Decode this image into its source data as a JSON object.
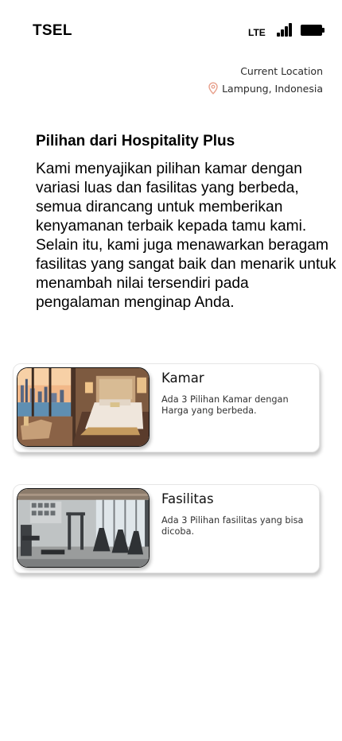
{
  "status_bar": {
    "carrier": "TSEL",
    "network": "LTE",
    "icons": [
      "signal-bars-icon",
      "battery-icon"
    ]
  },
  "location": {
    "label": "Current Location",
    "value": "Lampung, Indonesia",
    "icon": "map-pin-icon",
    "icon_color": "#e8a08c"
  },
  "section": {
    "title": "Pilihan dari Hospitality Plus",
    "description": "Kami menyajikan pilihan kamar dengan variasi luas dan fasilitas yang berbeda, semua dirancang untuk memberikan kenyamanan terbaik kepada tamu kami. Selain itu, kami juga menawarkan beragam fasilitas yang sangat baik dan menarik untuk menambah nilai tersendiri pada pengalaman menginap Anda."
  },
  "cards": [
    {
      "title": "Kamar",
      "description": "Ada 3 Pilihan Kamar dengan Harga yang berbeda.",
      "image": "hotel-room-photo"
    },
    {
      "title": "Fasilitas",
      "description": "Ada 3 Pilihan fasilitas yang bisa dicoba.",
      "image": "gym-facility-photo"
    }
  ]
}
